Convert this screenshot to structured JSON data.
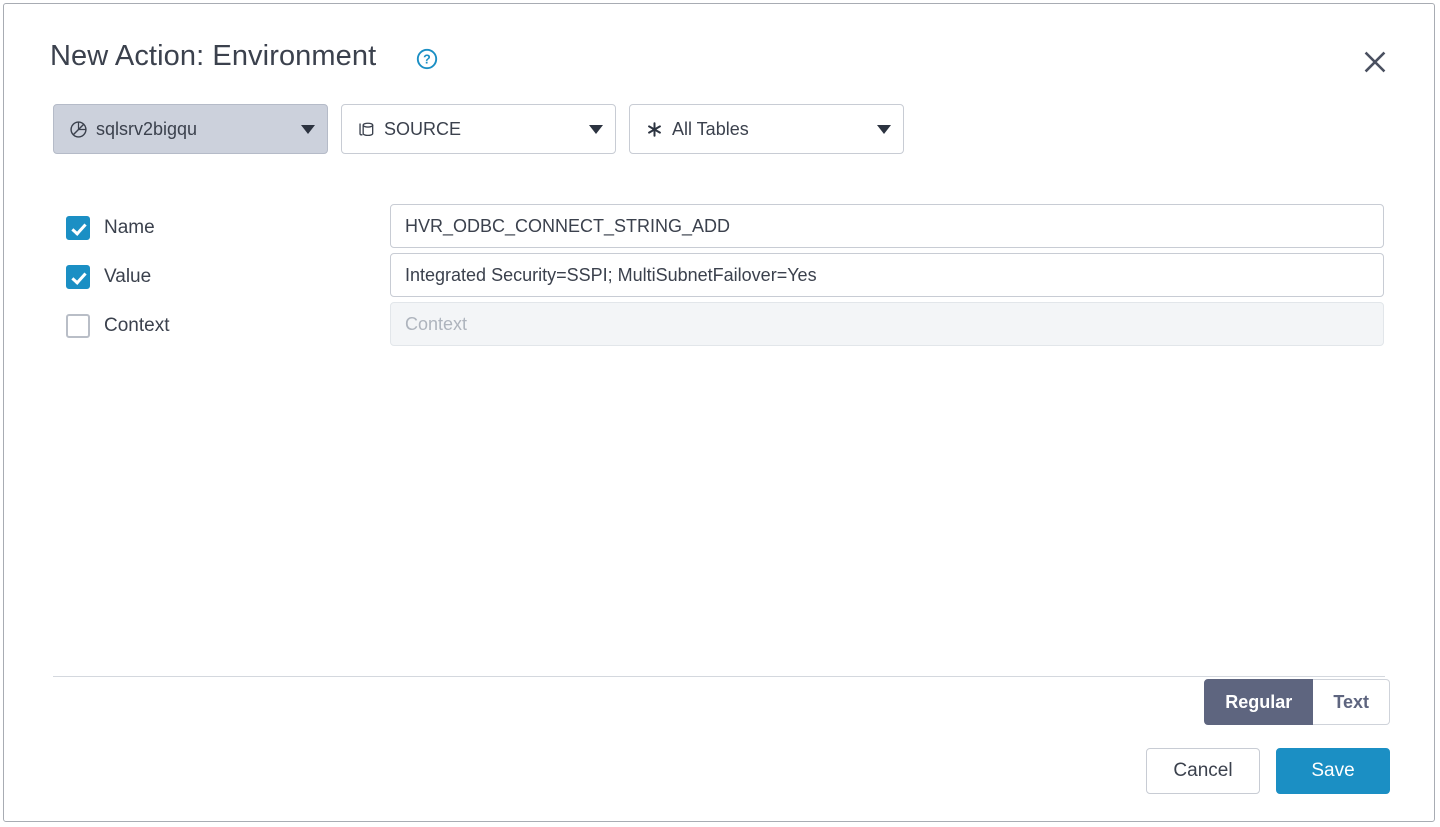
{
  "dialog": {
    "title": "New Action: Environment",
    "help_icon": "help-circle-icon",
    "close_icon": "close-icon"
  },
  "selectors": [
    {
      "icon": "location-hub-icon",
      "label": "sqlsrv2bigqu",
      "selected": true,
      "name": "location-select"
    },
    {
      "icon": "database-icon",
      "label": "SOURCE",
      "selected": false,
      "name": "source-select"
    },
    {
      "icon": "asterisk-icon",
      "label": "All Tables",
      "selected": false,
      "name": "tables-select"
    }
  ],
  "form": {
    "rows": [
      {
        "label": "Name",
        "checked": true,
        "value": "HVR_ODBC_CONNECT_STRING_ADD",
        "placeholder": "Name",
        "disabled": false
      },
      {
        "label": "Value",
        "checked": true,
        "value": "Integrated Security=SSPI; MultiSubnetFailover=Yes",
        "placeholder": "Value",
        "disabled": false
      },
      {
        "label": "Context",
        "checked": false,
        "value": "",
        "placeholder": "Context",
        "disabled": true
      }
    ]
  },
  "footer": {
    "mode_toggle": {
      "options": [
        "Regular",
        "Text"
      ],
      "selected": "Regular"
    },
    "cancel_label": "Cancel",
    "save_label": "Save"
  },
  "colors": {
    "accent": "#1b8fc4",
    "toggle_active": "#5e657f",
    "text": "#3b414d",
    "selected_chip": "#ccd1dc"
  }
}
